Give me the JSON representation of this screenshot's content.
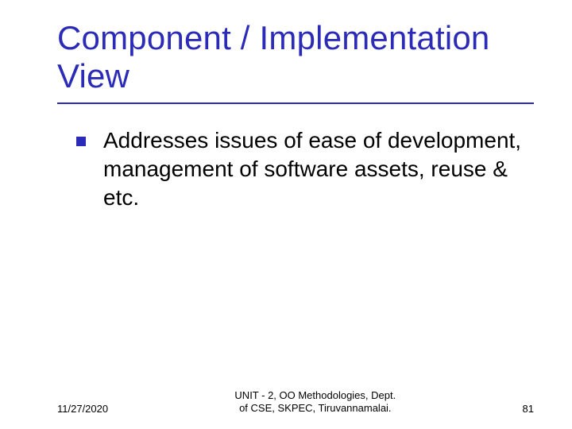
{
  "slide": {
    "title": "Component / Implementation View",
    "bullets": [
      "Addresses issues of ease of development, management of software assets, reuse & etc."
    ]
  },
  "footer": {
    "date": "11/27/2020",
    "center_line1": "UNIT - 2, OO Methodologies, Dept.",
    "center_line2": "of CSE, SKPEC, Tiruvannamalai.",
    "page": "81"
  },
  "colors": {
    "accent": "#2b2bb8"
  }
}
